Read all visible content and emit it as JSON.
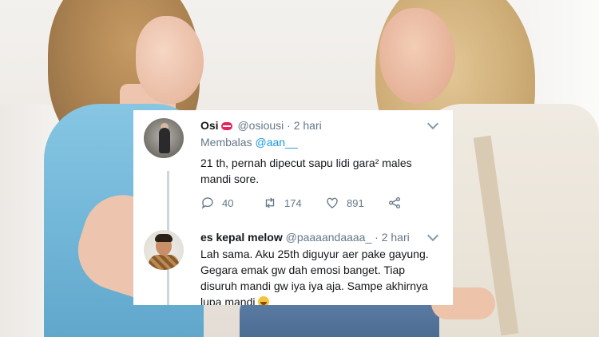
{
  "tweets": [
    {
      "name": "Osi",
      "name_emoji": "mouth-emoji",
      "handle": "@osiousi",
      "separator": "·",
      "time": "2 hari",
      "replying_label": "Membalas",
      "replying_to": "@aan__",
      "text_lines": [
        "21 th, pernah dipecut sapu lidi gara² males",
        "mandi sore."
      ],
      "stats": {
        "replies": "40",
        "retweets": "174",
        "likes": "891"
      }
    },
    {
      "name": "es kepal melow",
      "handle": "@paaaandaaaa_",
      "separator": "·",
      "time": "2 hari",
      "text_lines": [
        "Lah sama. Aku 25th diguyur aer pake gayung.",
        "Gegara emak gw dah emosi banget. Tiap",
        "disuruh mandi gw iya iya aja. Sampe akhirnya",
        "lupa mandi"
      ],
      "trailing_emoji": "rolling-laughing-emoji"
    }
  ],
  "colors": {
    "link": "#1b95e0",
    "muted": "#657786",
    "text": "#14171a",
    "mouth_emoji": "#e0245e"
  },
  "icons": [
    "reply-icon",
    "retweet-icon",
    "like-icon",
    "share-icon",
    "chevron-down-icon"
  ]
}
